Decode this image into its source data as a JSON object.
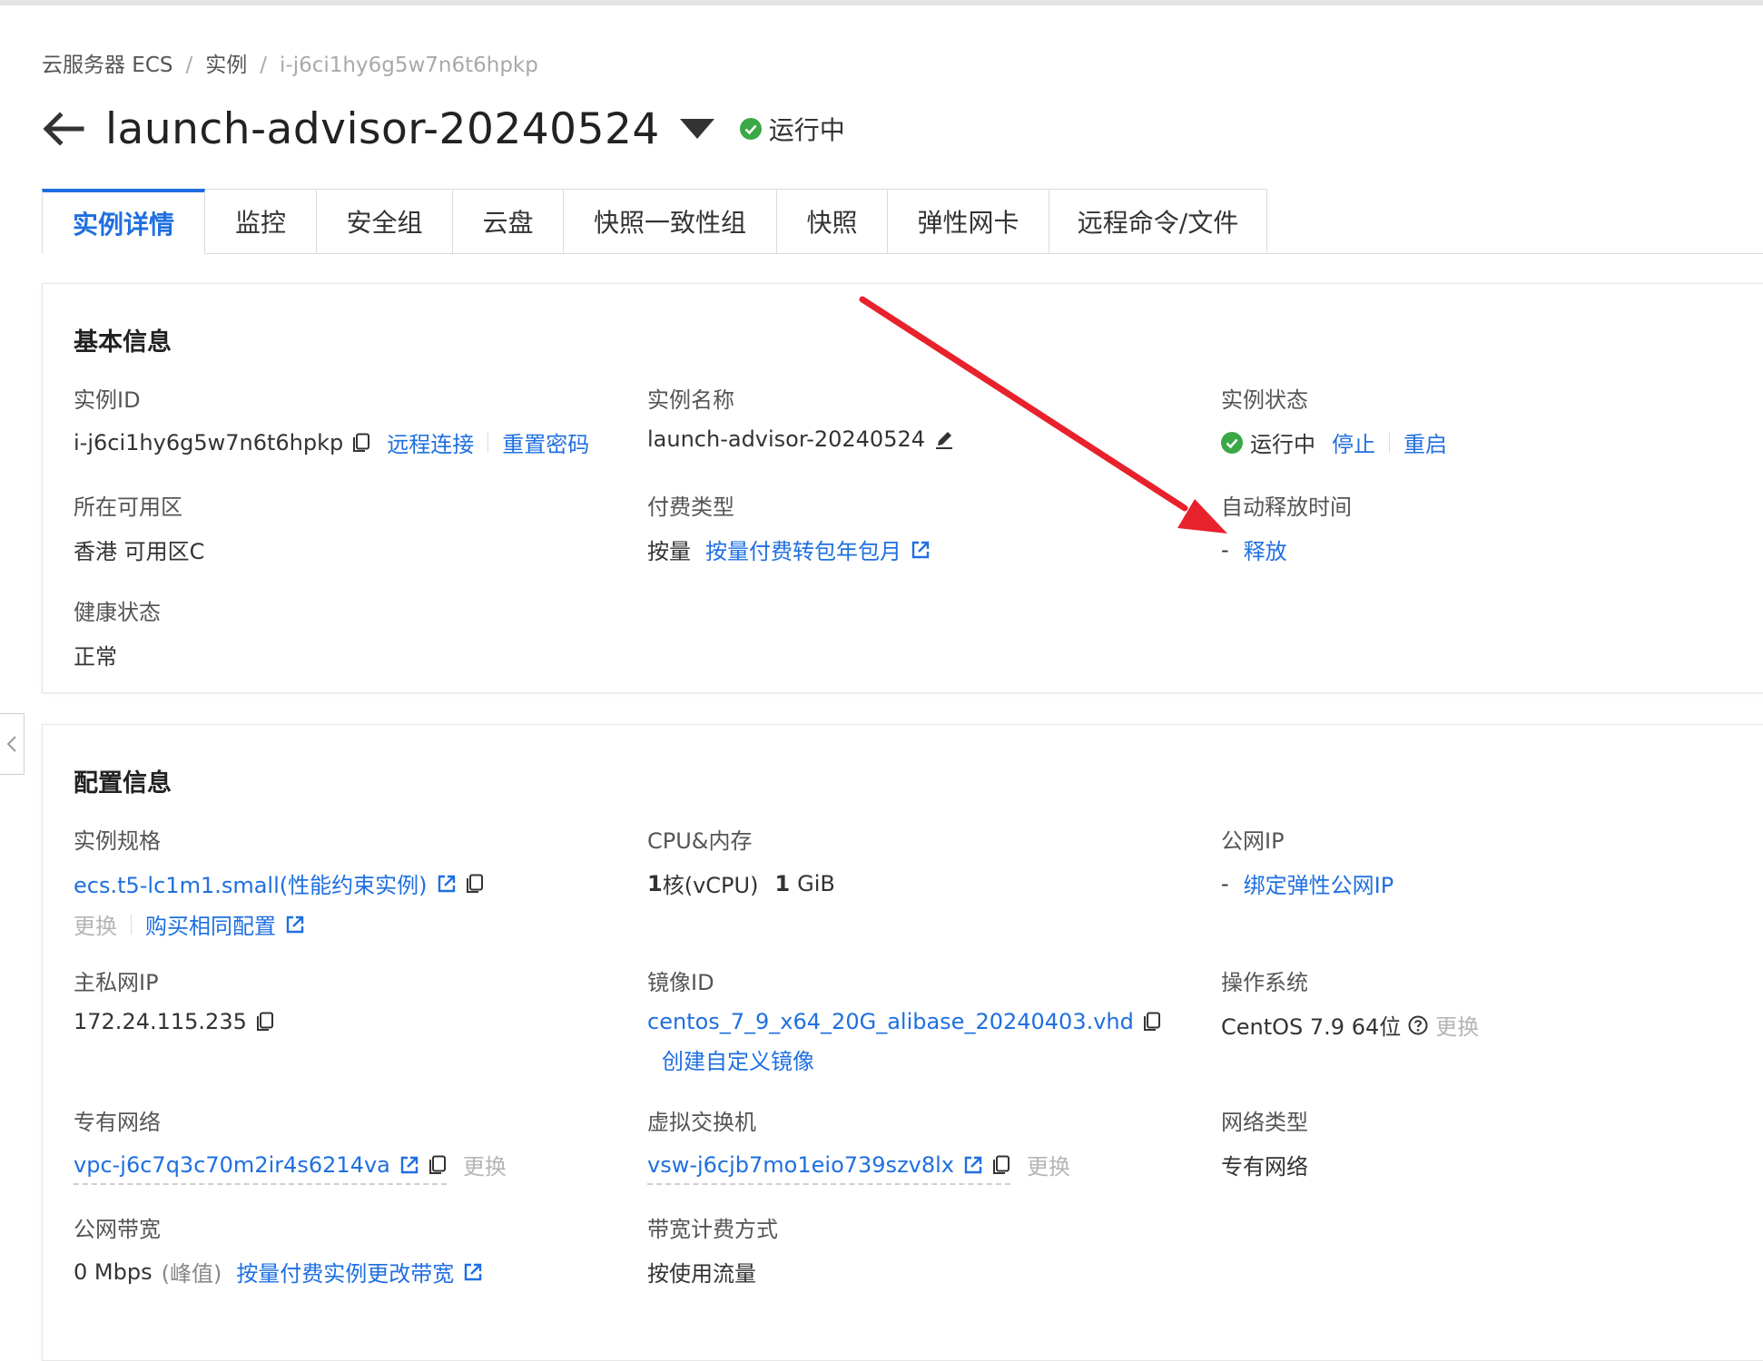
{
  "breadcrumb": {
    "items": [
      "云服务器 ECS",
      "实例",
      "i-j6ci1hy6g5w7n6t6hpkp"
    ],
    "sep": "/"
  },
  "header": {
    "title": "launch-advisor-20240524",
    "status": "运行中"
  },
  "tabs": [
    "实例详情",
    "监控",
    "安全组",
    "云盘",
    "快照一致性组",
    "快照",
    "弹性网卡",
    "远程命令/文件"
  ],
  "basic": {
    "title": "基本信息",
    "instance_id": {
      "label": "实例ID",
      "value": "i-j6ci1hy6g5w7n6t6hpkp",
      "remote_connect": "远程连接",
      "reset_password": "重置密码"
    },
    "instance_name": {
      "label": "实例名称",
      "value": "launch-advisor-20240524"
    },
    "instance_status": {
      "label": "实例状态",
      "value": "运行中",
      "stop": "停止",
      "restart": "重启"
    },
    "zone": {
      "label": "所在可用区",
      "value": "香港 可用区C"
    },
    "billing": {
      "label": "付费类型",
      "value": "按量",
      "convert_link": "按量付费转包年包月"
    },
    "auto_release": {
      "label": "自动释放时间",
      "value": "-",
      "release_link": "释放"
    },
    "health": {
      "label": "健康状态",
      "value": "正常"
    }
  },
  "config": {
    "title": "配置信息",
    "spec": {
      "label": "实例规格",
      "value": "ecs.t5-lc1m1.small(性能约束实例)",
      "change": "更换",
      "buy_same": "购买相同配置"
    },
    "cpu_mem": {
      "label": "CPU&内存",
      "cpu_num": "1",
      "cpu_unit": "核(vCPU)",
      "mem_num": "1",
      "mem_unit": "GiB"
    },
    "public_ip": {
      "label": "公网IP",
      "value": "-",
      "bind_link": "绑定弹性公网IP"
    },
    "private_ip": {
      "label": "主私网IP",
      "value": "172.24.115.235"
    },
    "image_id": {
      "label": "镜像ID",
      "value": "centos_7_9_x64_20G_alibase_20240403.vhd",
      "create_link": "创建自定义镜像"
    },
    "os": {
      "label": "操作系统",
      "value": "CentOS 7.9 64位",
      "change": "更换"
    },
    "vpc": {
      "label": "专有网络",
      "value": "vpc-j6c7q3c70m2ir4s6214va",
      "change": "更换"
    },
    "vswitch": {
      "label": "虚拟交换机",
      "value": "vsw-j6cjb7mo1eio739szv8lx",
      "change": "更换"
    },
    "network_type": {
      "label": "网络类型",
      "value": "专有网络"
    },
    "bandwidth": {
      "label": "公网带宽",
      "value": "0 Mbps",
      "peak": "(峰值)",
      "change_link": "按量付费实例更改带宽"
    },
    "bandwidth_billing": {
      "label": "带宽计费方式",
      "value": "按使用流量"
    }
  },
  "colors": {
    "accent": "#1f6fe0",
    "success": "#3aa845",
    "annotation": "#e8222c"
  }
}
